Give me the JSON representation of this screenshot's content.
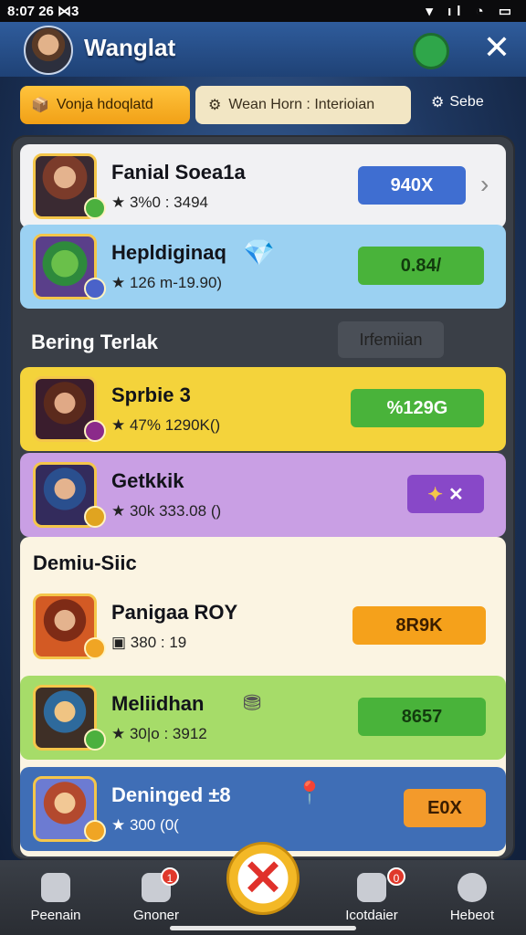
{
  "status_bar": {
    "time": "8:07 26 ⋈3",
    "icons": "▾ ıl ◔ ▭"
  },
  "header": {
    "title": "Wanglat"
  },
  "tabs": [
    {
      "label": "Vonja hdoqlatd"
    },
    {
      "label": "Wean Horn : Interioian"
    },
    {
      "label": "Sebe"
    }
  ],
  "top_rows": [
    {
      "name": "Fanial Soea1a",
      "stats": "★ 3%0 : 3494",
      "button": "940X",
      "bg": "#f1f1f3",
      "btn_color": "#3f6ed1",
      "pic": "#7b3b2a"
    },
    {
      "name": "Hepldiginaq",
      "stats": "★ 126 m-19.90)",
      "button": "0.84/",
      "bg": "#9bd1f2",
      "btn_color": "#49b33a",
      "pic": "#2e8a3c"
    }
  ],
  "section1": {
    "title": "Bering Terlak",
    "action": "Irfemiian"
  },
  "mid_rows": [
    {
      "name": "Sprbie 3",
      "stats": "★ 47% 1290K()",
      "button": "%129G",
      "bg": "#f4d33b",
      "btn_color": "#49b33a",
      "pic": "#5b2a1c"
    },
    {
      "name": "Getkkik",
      "stats": "★ 30k 333.08 ()",
      "button": "✕",
      "bg": "#c99fe4",
      "btn_color": "#8848c8",
      "pic": "#2a4f8e"
    }
  ],
  "section2": {
    "title": "Demiu-Siic"
  },
  "bottom_rows": [
    {
      "name": "Panigaa ROY",
      "stats": "▣ 380 : 19",
      "button": "8R9K",
      "bg": "#fbf4e2",
      "btn_color": "#f5a11b",
      "pic": "#7e2b16"
    },
    {
      "name": "Meliidhan",
      "stats": "★ 30|o : 3912",
      "button": "8657",
      "bg": "#a6dc69",
      "btn_color": "#49b33a",
      "pic": "#2e6a9c"
    },
    {
      "name": "Deninged ±8",
      "stats": "★ 300 (0(",
      "button": "E0X",
      "bg": "#3f6eb6",
      "btn_color": "#f39a2b",
      "pic": "#b3492e"
    }
  ],
  "nav": [
    {
      "label": "Peenain"
    },
    {
      "label": "Gnoner"
    },
    {
      "label": "Icotdaier"
    },
    {
      "label": "Hebeot"
    }
  ]
}
